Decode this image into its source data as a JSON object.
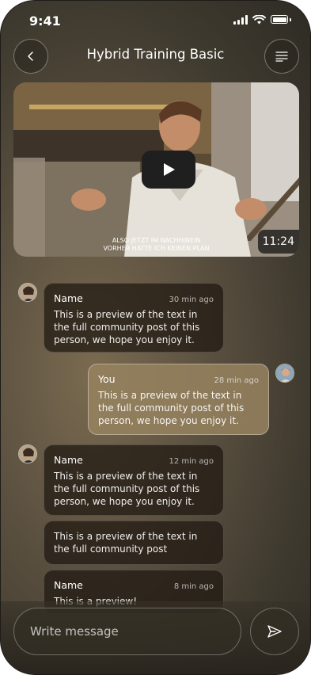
{
  "status_bar": {
    "time": "9:41"
  },
  "header": {
    "title": "Hybrid Training Basic"
  },
  "video": {
    "caption_line1": "ALSO JETZT IM NACHHINEIN",
    "caption_line2": "VORHER HATTE ICH KEINEN PLAN",
    "duration": "11:24"
  },
  "messages": [
    {
      "name": "Name",
      "time": "30 min ago",
      "text": "This is a preview of the text in the full community post of this person, we hope you enjoy it."
    },
    {
      "name": "You",
      "time": "28 min ago",
      "text": "This is a preview of the text in the full community post of this person, we hope you enjoy it."
    },
    {
      "name": "Name",
      "time": "12 min ago",
      "text": "This is a preview of the text in the full community post of this person, we hope you enjoy it."
    },
    {
      "name": "",
      "time": "",
      "text": "This is a preview of the text in the full community post"
    },
    {
      "name": "Name",
      "time": "8 min ago",
      "text": "This is a preview!"
    }
  ],
  "composer": {
    "placeholder": "Write message"
  },
  "icons": {
    "back": "chevron-left-icon",
    "menu": "menu-lines-icon",
    "play": "play-icon",
    "send": "send-icon"
  }
}
